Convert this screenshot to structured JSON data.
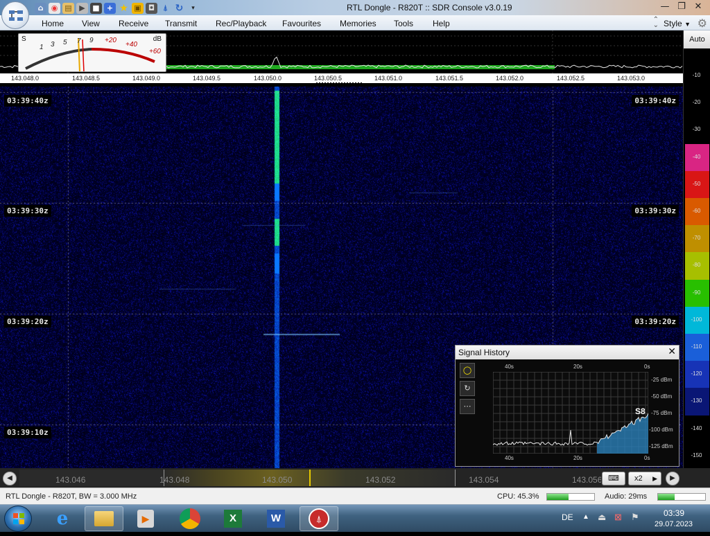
{
  "window": {
    "title": "RTL Dongle - R820T :: SDR Console v3.0.19",
    "controls": [
      "—",
      "❐",
      "✕"
    ]
  },
  "menu": {
    "items": [
      "Home",
      "View",
      "Receive",
      "Transmit",
      "Rec/Playback",
      "Favourites",
      "Memories",
      "Tools",
      "Help"
    ],
    "style_label": "Style"
  },
  "smeter": {
    "s_label": "S",
    "db_label": "dB",
    "scale": [
      "1",
      "3",
      "5",
      "7",
      "9",
      "+20",
      "+40",
      "+60"
    ]
  },
  "spectrum": {
    "frequency_labels": [
      "143.048.0",
      "143.048.5",
      "143.049.0",
      "143.049.5",
      "143.050.0",
      "143.050.5",
      "143.051.0",
      "143.051.5",
      "143.052.0",
      "143.052.5",
      "143.053.0"
    ]
  },
  "waterfall": {
    "time_labels": [
      "03:39:40z",
      "03:39:30z",
      "03:39:20z",
      "03:39:10z"
    ]
  },
  "db_scale": {
    "auto_label": "Auto",
    "labels": [
      "-10",
      "-20",
      "-30",
      "-40",
      "-50",
      "-60",
      "-70",
      "-80",
      "-90",
      "-100",
      "-110",
      "-120",
      "-130",
      "-140",
      "-150"
    ],
    "band_colors": [
      "#ff2b9a",
      "#ff1a1a",
      "#ff6a00",
      "#e0a800",
      "#c4e000",
      "#2fe000",
      "#00d8ff",
      "#1f70ff",
      "#1b3cd6",
      "#0c1a8a"
    ]
  },
  "signal_history": {
    "title": "Signal History",
    "close": "✕",
    "buttons": [
      "◯",
      "↻",
      "⋯"
    ],
    "top_labels": [
      "40s",
      "20s",
      "0s"
    ],
    "bottom_labels": [
      "40s",
      "20s",
      "0s"
    ],
    "dbm_labels": [
      "-25 dBm",
      "-50 dBm",
      "-75 dBm",
      "-100 dBm",
      "-125 dBm"
    ],
    "s_reading": "S8"
  },
  "tuning_bar": {
    "frequencies": [
      "143.046",
      "143.048",
      "143.050",
      "143.052",
      "143.054",
      "143.056"
    ],
    "zoom": "x2"
  },
  "status": {
    "device": "RTL Dongle - R820T, BW = 3.000 MHz",
    "cpu": "CPU: 45.3%",
    "cpu_percent": 45.3,
    "audio": "Audio: 29ms",
    "audio_level": 0.35
  },
  "taskbar": {
    "lang": "DE",
    "time": "03:39",
    "date": "29.07.2023"
  }
}
